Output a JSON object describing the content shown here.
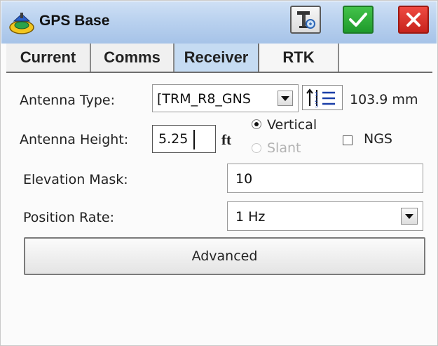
{
  "window": {
    "title": "GPS Base"
  },
  "titlebar_buttons": {
    "tools_icon": "antenna-tools-icon",
    "ok_icon": "checkmark-icon",
    "cancel_icon": "close-icon"
  },
  "tabs": [
    {
      "label": "Current",
      "selected": false
    },
    {
      "label": "Comms",
      "selected": false
    },
    {
      "label": "Receiver",
      "selected": true
    },
    {
      "label": "RTK",
      "selected": false
    }
  ],
  "antenna_type": {
    "label": "Antenna Type:",
    "value": "[TRM_R8_GNS",
    "offset_value": "103.9 mm"
  },
  "antenna_height": {
    "label": "Antenna Height:",
    "value": "5.25",
    "unit": "ft",
    "vertical_label": "Vertical",
    "slant_label": "Slant",
    "selected_method": "Vertical",
    "ngs_label": "NGS",
    "ngs_checked": false
  },
  "elevation_mask": {
    "label": "Elevation Mask:",
    "value": "10"
  },
  "position_rate": {
    "label": "Position Rate:",
    "value": "1 Hz"
  },
  "advanced_button": {
    "label": "Advanced"
  },
  "colors": {
    "ok_green": "#22a32f",
    "cancel_red": "#d82a22",
    "selected_tab": "#c5dbf2",
    "titlebar": "#bad2ef"
  }
}
